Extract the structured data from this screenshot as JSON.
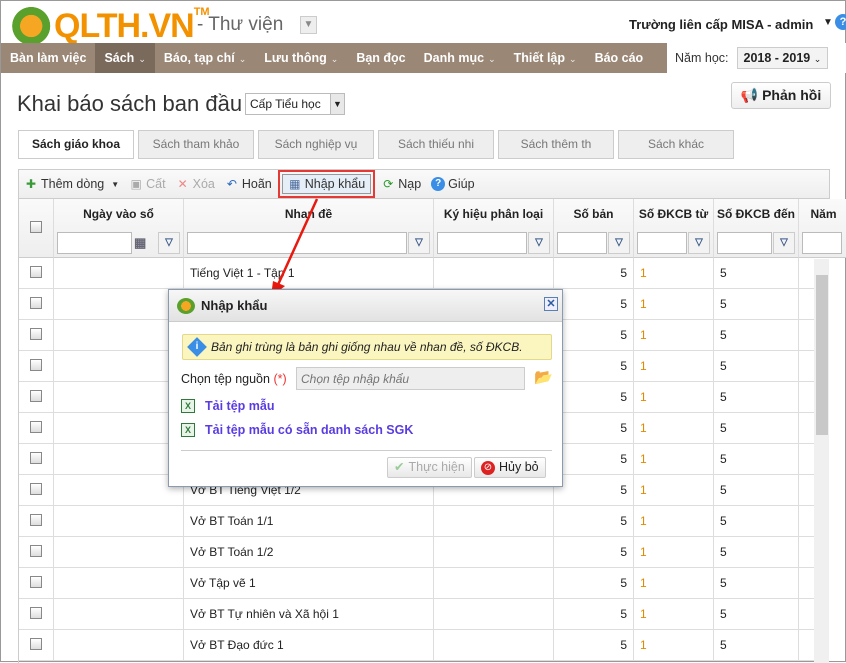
{
  "header": {
    "logo": "QLTH.VN",
    "tm": "TM",
    "module": "- Thư viện",
    "user": "Trường liên cấp MISA - admin"
  },
  "nav": {
    "items": [
      {
        "label": "Bàn làm việc",
        "chev": false
      },
      {
        "label": "Sách",
        "chev": true
      },
      {
        "label": "Báo, tạp chí",
        "chev": true
      },
      {
        "label": "Lưu thông",
        "chev": true
      },
      {
        "label": "Bạn đọc",
        "chev": false
      },
      {
        "label": "Danh mục",
        "chev": true
      },
      {
        "label": "Thiết lập",
        "chev": true
      },
      {
        "label": "Báo cáo",
        "chev": false
      }
    ],
    "year_label": "Năm học:",
    "year": "2018 - 2019"
  },
  "page": {
    "title": "Khai báo sách ban đầu",
    "level": "Cấp Tiểu học",
    "feedback": "Phản hồi"
  },
  "tabs": [
    "Sách giáo khoa",
    "Sách tham khảo",
    "Sách nghiệp vụ",
    "Sách thiếu nhi",
    "Sách thêm th",
    "Sách khác"
  ],
  "toolbar": {
    "add": "Thêm dòng",
    "cut": "Cất",
    "delete": "Xóa",
    "undo": "Hoãn",
    "import": "Nhập khẩu",
    "reload": "Nạp",
    "help": "Giúp"
  },
  "columns": [
    "Ngày vào sổ",
    "Nhan đề",
    "Ký hiệu phân loại",
    "Số bản",
    "Số ĐKCB từ",
    "Số ĐKCB đến",
    "Năm"
  ],
  "rows": [
    {
      "title": "Tiếng Việt 1 - Tập 1",
      "copies": "5",
      "from": "1",
      "to": "5"
    },
    {
      "title": "",
      "copies": "5",
      "from": "1",
      "to": "5"
    },
    {
      "title": "",
      "copies": "5",
      "from": "1",
      "to": "5"
    },
    {
      "title": "",
      "copies": "5",
      "from": "1",
      "to": "5"
    },
    {
      "title": "",
      "copies": "5",
      "from": "1",
      "to": "5"
    },
    {
      "title": "",
      "copies": "5",
      "from": "1",
      "to": "5"
    },
    {
      "title": "",
      "copies": "5",
      "from": "1",
      "to": "5"
    },
    {
      "title": "Vở BT Tiếng Việt 1/2",
      "copies": "5",
      "from": "1",
      "to": "5"
    },
    {
      "title": "Vở BT Toán 1/1",
      "copies": "5",
      "from": "1",
      "to": "5"
    },
    {
      "title": "Vở BT Toán 1/2",
      "copies": "5",
      "from": "1",
      "to": "5"
    },
    {
      "title": "Vở Tập vẽ 1",
      "copies": "5",
      "from": "1",
      "to": "5"
    },
    {
      "title": "Vở BT Tự nhiên và Xã hội 1",
      "copies": "5",
      "from": "1",
      "to": "5"
    },
    {
      "title": "Vở BT Đạo đức 1",
      "copies": "5",
      "from": "1",
      "to": "5"
    }
  ],
  "dialog": {
    "title": "Nhập khẩu",
    "info": "Bản ghi trùng là bản ghi giống nhau về nhan đề, số ĐKCB.",
    "source_label": "Chọn tệp nguồn",
    "required": "(*)",
    "source_placeholder": "Chọn tệp nhập khẩu",
    "link1": "Tải tệp mẫu",
    "link2": "Tải tệp mẫu có sẵn danh sách SGK",
    "ok": "Thực hiện",
    "cancel": "Hủy bỏ"
  },
  "colors": {
    "nav": "#9a8776",
    "brand": "#f39200",
    "highlight": "#e53935",
    "link": "#5a3ce0"
  }
}
